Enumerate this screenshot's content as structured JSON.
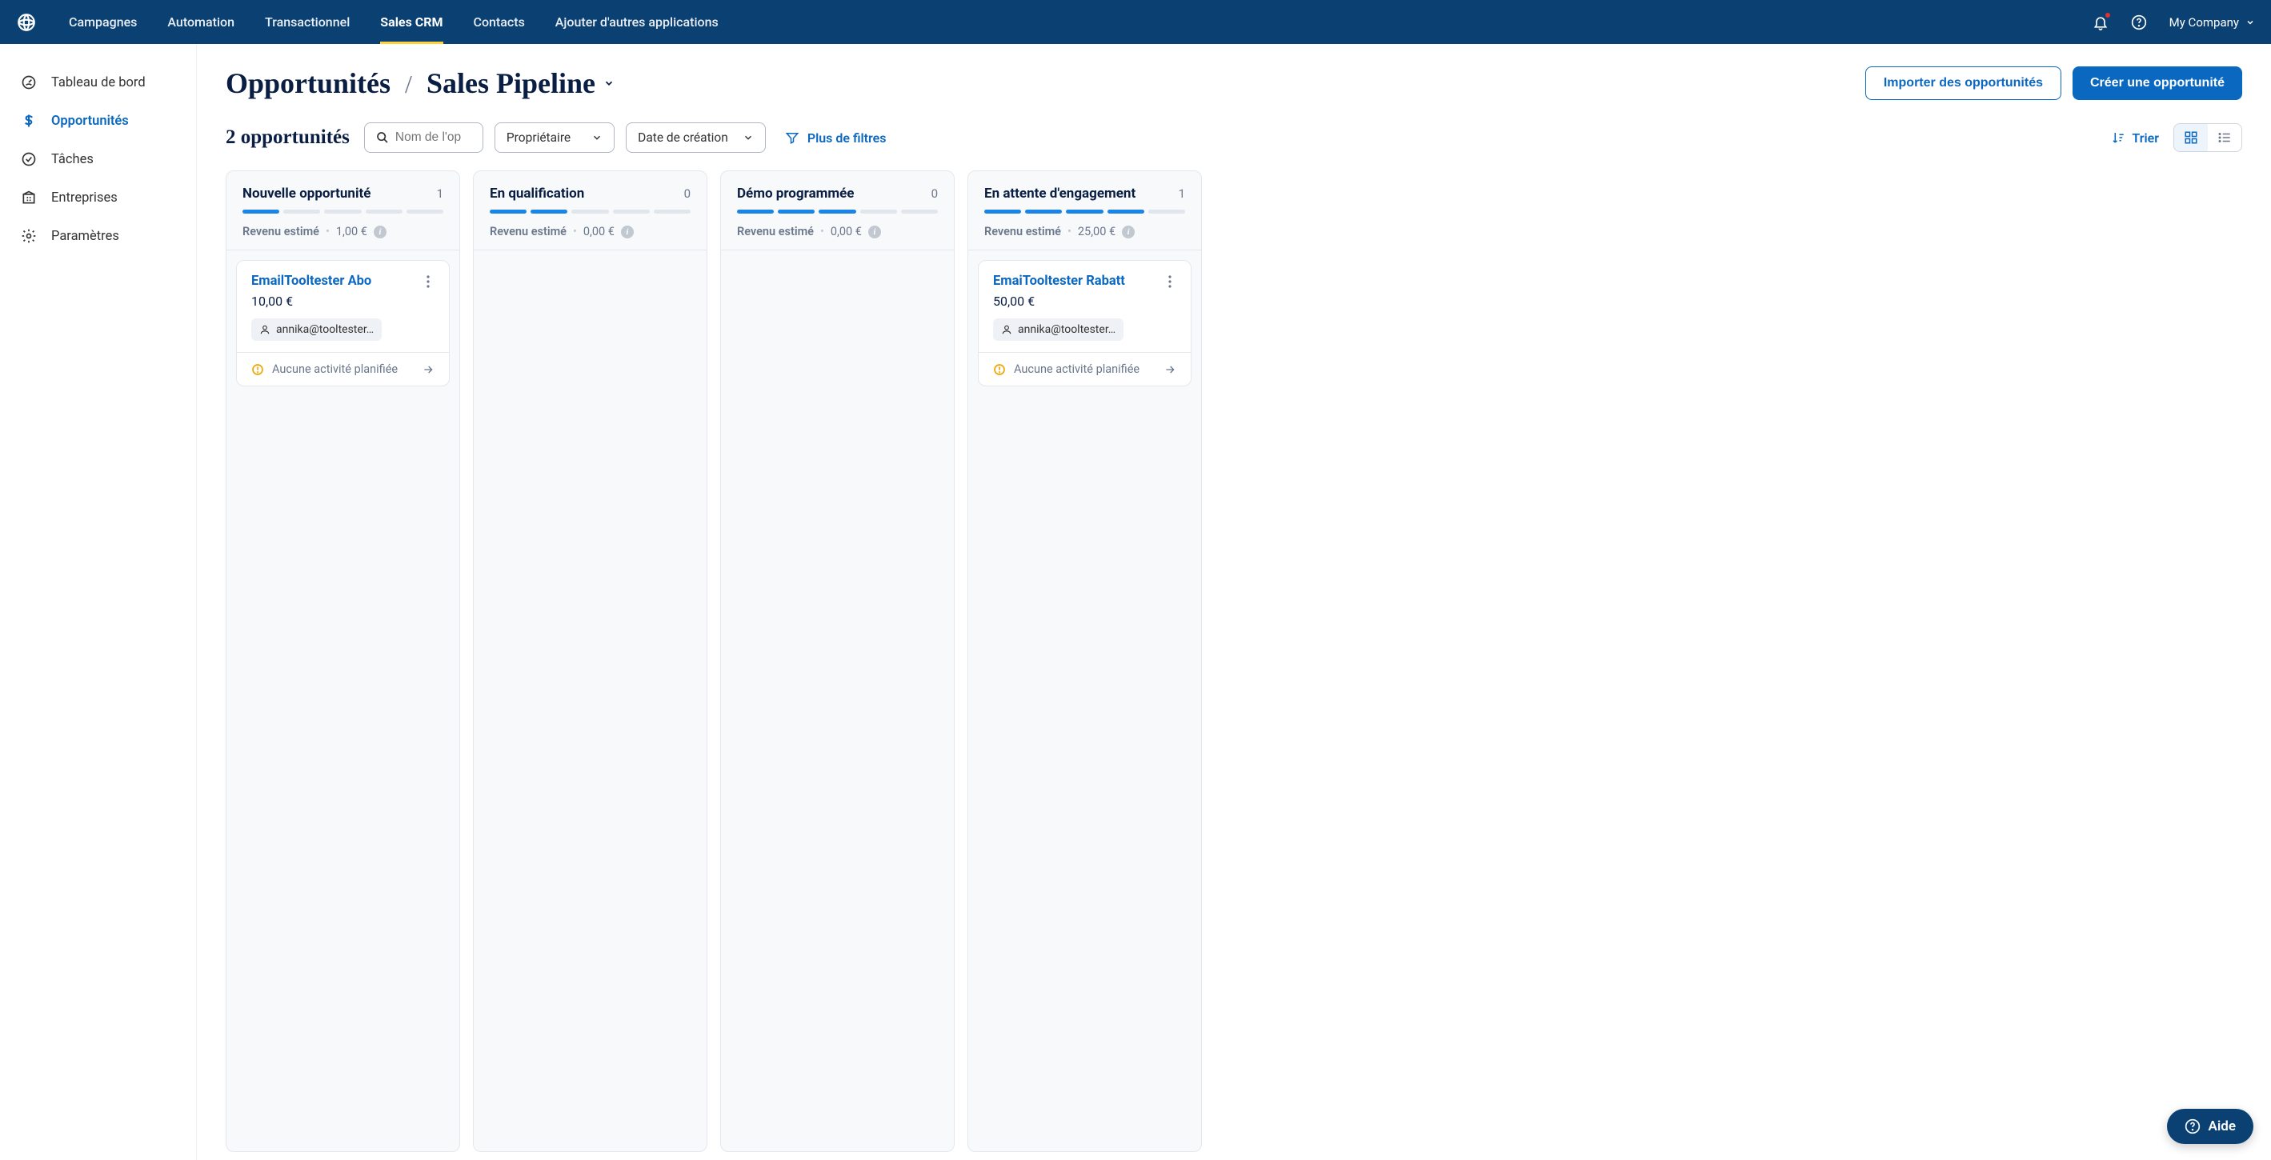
{
  "topnav": {
    "items": [
      "Campagnes",
      "Automation",
      "Transactionnel",
      "Sales CRM",
      "Contacts",
      "Ajouter d'autres applications"
    ],
    "active_index": 3
  },
  "company_label": "My Company",
  "sidebar": {
    "items": [
      {
        "label": "Tableau de bord",
        "icon": "dashboard"
      },
      {
        "label": "Opportunités",
        "icon": "currency"
      },
      {
        "label": "Tâches",
        "icon": "check-circle"
      },
      {
        "label": "Entreprises",
        "icon": "building"
      },
      {
        "label": "Paramètres",
        "icon": "gear"
      }
    ],
    "active_index": 1
  },
  "header": {
    "title": "Opportunités",
    "pipeline": "Sales Pipeline",
    "import_btn": "Importer des opportunités",
    "create_btn": "Créer une opportunité"
  },
  "filters": {
    "count_label": "2 opportunités",
    "search_placeholder": "Nom de l'op",
    "owner_label": "Propriétaire",
    "created_label": "Date de création",
    "more_label": "Plus de filtres",
    "sort_label": "Trier"
  },
  "board": {
    "revenue_label": "Revenu estimé",
    "no_activity_label": "Aucune activité planifiée",
    "columns": [
      {
        "title": "Nouvelle opportunité",
        "count": "1",
        "progress_on": 1,
        "revenue": "1,00 €",
        "cards": [
          {
            "title": "EmailTooltester Abo",
            "price": "10,00 €",
            "contact": "annika@tooltester…"
          }
        ]
      },
      {
        "title": "En qualification",
        "count": "0",
        "progress_on": 2,
        "revenue": "0,00 €",
        "cards": []
      },
      {
        "title": "Démo programmée",
        "count": "0",
        "progress_on": 3,
        "revenue": "0,00 €",
        "cards": []
      },
      {
        "title": "En attente d'engagement",
        "count": "1",
        "progress_on": 4,
        "revenue": "25,00 €",
        "cards": [
          {
            "title": "EmaiTooltester Rabatt",
            "price": "50,00 €",
            "contact": "annika@tooltester…"
          }
        ]
      }
    ]
  },
  "help_label": "Aide"
}
